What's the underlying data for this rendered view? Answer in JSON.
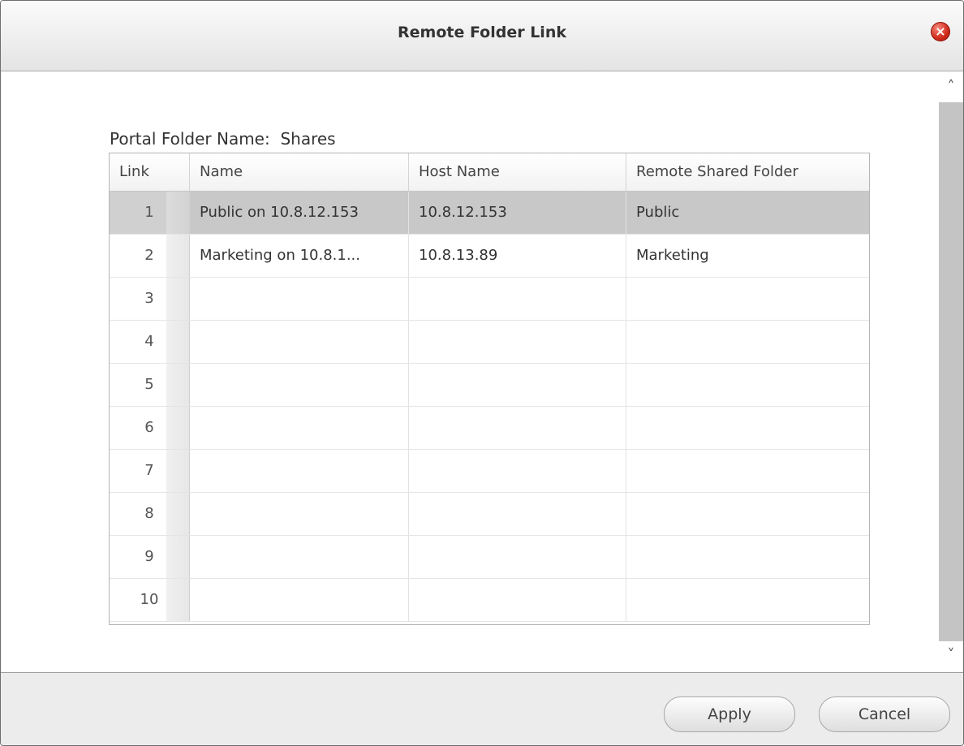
{
  "dialog": {
    "title": "Remote Folder Link",
    "close_icon": "close-icon"
  },
  "portal": {
    "label": "Portal Folder Name:",
    "value": "Shares"
  },
  "table": {
    "headers": [
      "Link",
      "Name",
      "Host Name",
      "Remote Shared Folder"
    ],
    "rows": [
      {
        "link": "1",
        "name": "Public on 10.8.12.153",
        "host": "10.8.12.153",
        "folder": "Public",
        "selected": true
      },
      {
        "link": "2",
        "name": "Marketing on 10.8.1...",
        "host": "10.8.13.89",
        "folder": "Marketing"
      },
      {
        "link": "3",
        "name": "",
        "host": "",
        "folder": ""
      },
      {
        "link": "4",
        "name": "",
        "host": "",
        "folder": ""
      },
      {
        "link": "5",
        "name": "",
        "host": "",
        "folder": ""
      },
      {
        "link": "6",
        "name": "",
        "host": "",
        "folder": ""
      },
      {
        "link": "7",
        "name": "",
        "host": "",
        "folder": ""
      },
      {
        "link": "8",
        "name": "",
        "host": "",
        "folder": ""
      },
      {
        "link": "9",
        "name": "",
        "host": "",
        "folder": ""
      },
      {
        "link": "10",
        "name": "",
        "host": "",
        "folder": ""
      }
    ]
  },
  "scrollbar": {
    "up_icon": "chevron-up-icon",
    "down_icon": "chevron-down-icon"
  },
  "footer": {
    "apply_label": "Apply",
    "cancel_label": "Cancel"
  }
}
